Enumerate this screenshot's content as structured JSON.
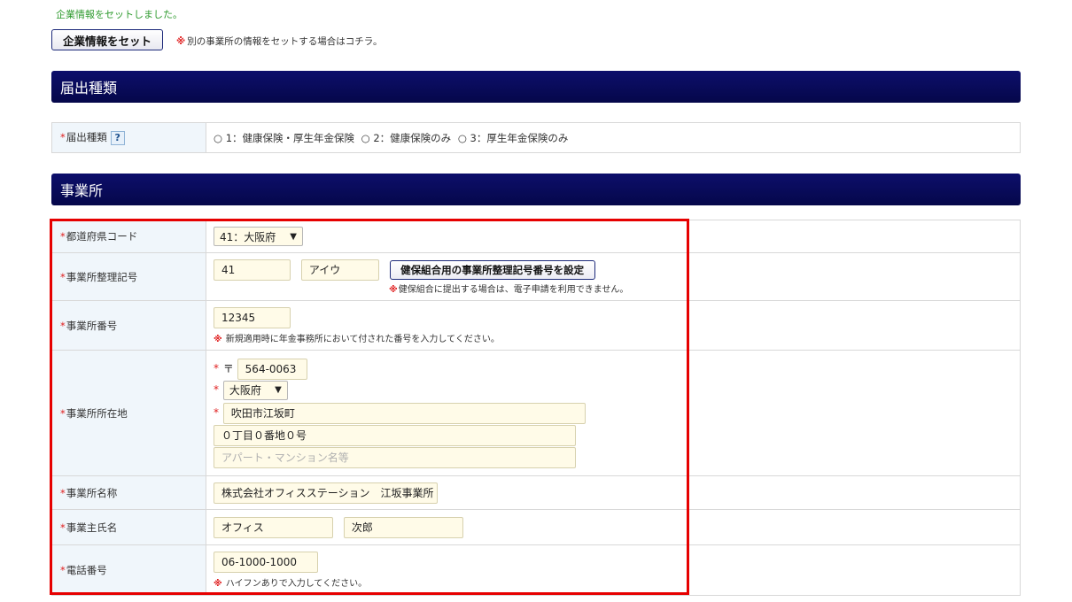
{
  "top_message": "企業情報をセットしました。",
  "company_button": "企業情報をセット",
  "company_note_mark": "※",
  "company_note": "別の事業所の情報をセットする場合はコチラ。",
  "sections": {
    "filing_type": "届出種類",
    "office": "事業所"
  },
  "filing": {
    "label": "届出種類",
    "help": "?",
    "options": [
      "○ 1：健康保険・厚生年金保険",
      "○ 2：健康保険のみ",
      "○ 3：厚生年金保険のみ"
    ]
  },
  "req_mark": "*",
  "office": {
    "pref_code": {
      "label": "都道府県コード",
      "value": "41：大阪府"
    },
    "reg_symbol": {
      "label": "事業所整理記号",
      "value1": "41",
      "value2": "アイウ",
      "button": "健保組合用の事業所整理記号番号を設定",
      "note_mark": "※",
      "note": "健保組合に提出する場合は、電子申請を利用できません。"
    },
    "number": {
      "label": "事業所番号",
      "value": "12345",
      "note_mark": "※",
      "note": "新規適用時に年金事務所において付された番号を入力してください。"
    },
    "address": {
      "label": "事業所所在地",
      "postal_mark": "〒",
      "postal": "564-0063",
      "prefecture": "大阪府",
      "city": "吹田市江坂町",
      "street": "０丁目０番地０号",
      "building_placeholder": "アパート・マンション名等"
    },
    "name": {
      "label": "事業所名称",
      "value": "株式会社オフィスステーション　江坂事業所"
    },
    "owner": {
      "label": "事業主氏名",
      "last": "オフィス",
      "first": "次郎"
    },
    "phone": {
      "label": "電話番号",
      "value": "06-1000-1000",
      "note_mark": "※",
      "note": "ハイフンありで入力してください。"
    }
  },
  "colors": {
    "section_bar": "#0d0f6b",
    "required": "#e02020",
    "highlight": "#e60000",
    "success_text": "#2e9a2e",
    "input_bg": "#fffbe8"
  }
}
